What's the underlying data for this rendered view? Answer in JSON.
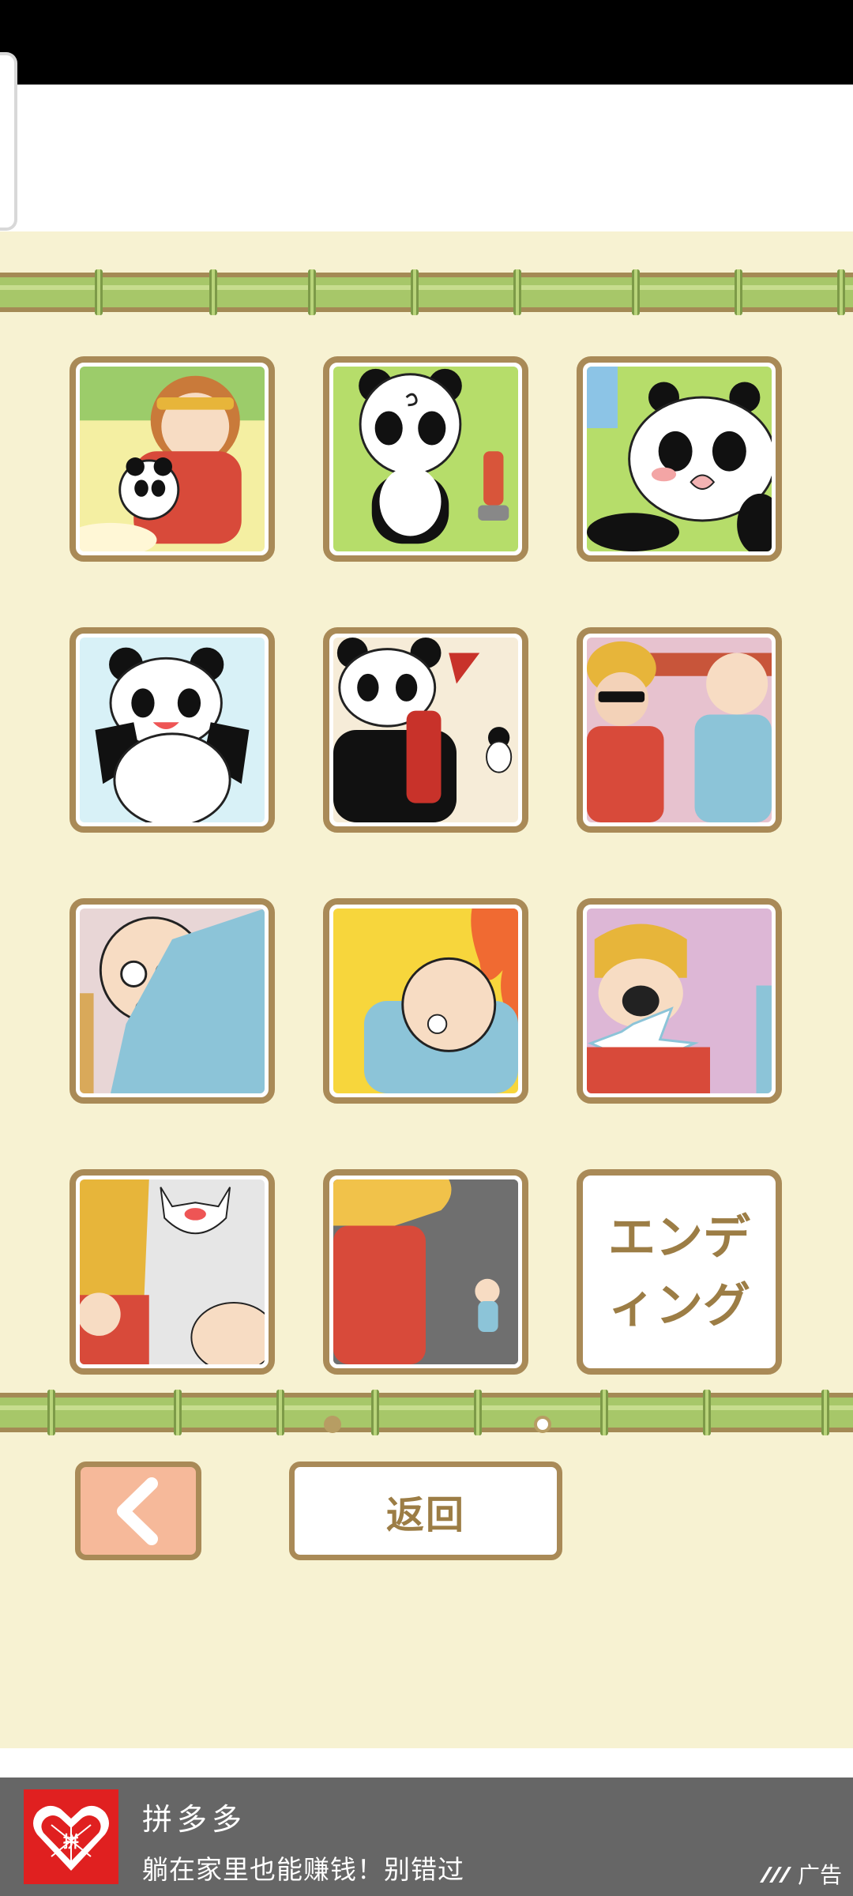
{
  "gallery": {
    "tiles": [
      {
        "scene": "monkey-king-hugging-panda",
        "bg": "#f4efa2"
      },
      {
        "scene": "dizzy-panda-fire-hydrant",
        "bg": "#b6dd6a"
      },
      {
        "scene": "crying-panda",
        "bg": "#b6dd6a"
      },
      {
        "scene": "happy-panda-waving",
        "bg": "#d8f1f7"
      },
      {
        "scene": "panda-with-fire-extinguisher",
        "bg": "#f6ecd8"
      },
      {
        "scene": "two-workers-in-uniforms",
        "bg": "#e7c2cf"
      },
      {
        "scene": "dizzy-bald-worker",
        "bg": "#e8d6d6"
      },
      {
        "scene": "bald-worker-near-fire",
        "bg": "#f7d63c"
      },
      {
        "scene": "worker-shouting",
        "bg": "#ddb7d6"
      },
      {
        "scene": "angry-cat-and-workers",
        "bg": "#e6e6e6"
      },
      {
        "scene": "dog-and-tiny-worker",
        "bg": "#8a8a8a"
      }
    ],
    "ending_label": "エンディング"
  },
  "controls": {
    "back_label": "返回",
    "prev_icon": "chevron-left-icon",
    "page_count": 2,
    "current_page": 2
  },
  "ad": {
    "title": "拼多多",
    "description": "躺在家里也能赚钱！别错过",
    "badge": "广告",
    "logo_text": "拼"
  }
}
